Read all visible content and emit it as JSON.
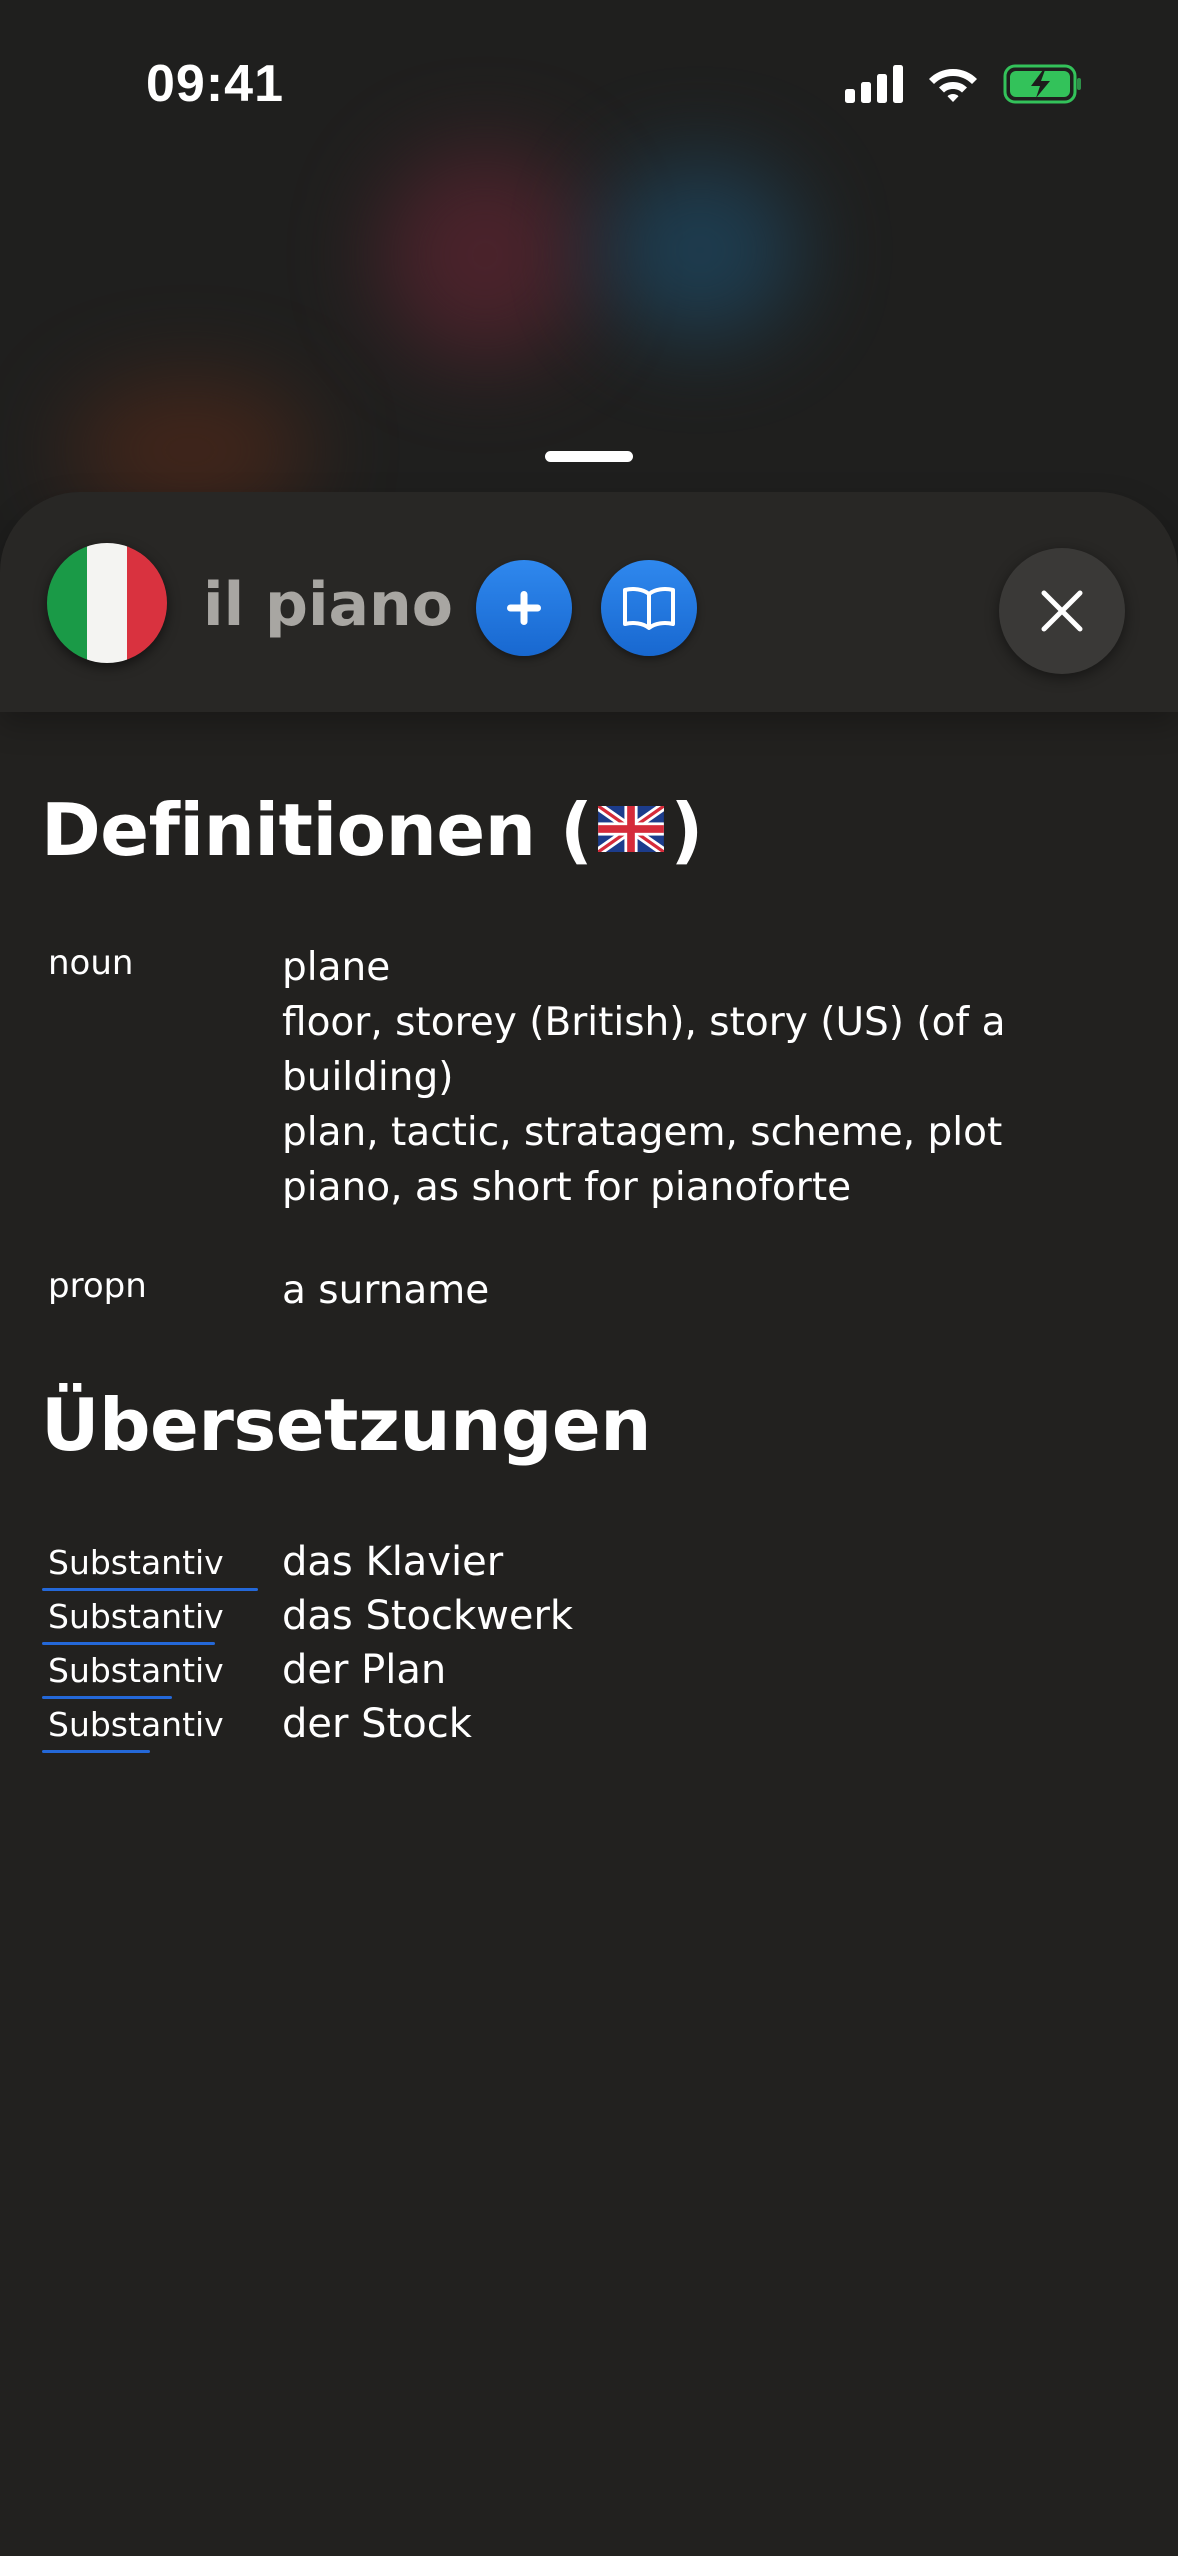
{
  "status_bar": {
    "time": "09:41",
    "icons": [
      "signal-icon",
      "wifi-icon",
      "battery-charging-icon"
    ]
  },
  "header": {
    "language_flag": "italy-flag-icon",
    "word": "il piano",
    "add_icon": "plus-icon",
    "dictionary_icon": "open-book-icon",
    "close_icon": "close-icon"
  },
  "definitions": {
    "title_prefix": "Definitionen (",
    "title_suffix": ")",
    "flag": "uk-flag-icon",
    "entries": [
      {
        "pos": "noun",
        "lines": [
          "plane",
          "floor, storey (British), story (US) (of a",
          "building)",
          "plan, tactic, stratagem, scheme, plot",
          "piano, as short for pianoforte"
        ]
      },
      {
        "pos": "propn",
        "lines": [
          "a surname"
        ]
      }
    ]
  },
  "translations": {
    "title": "Übersetzungen",
    "rows": [
      {
        "pos": "Substantiv",
        "word": "das Klavier",
        "relevance": 1.0
      },
      {
        "pos": "Substantiv",
        "word": "das Stockwerk",
        "relevance": 0.8
      },
      {
        "pos": "Substantiv",
        "word": "der Plan",
        "relevance": 0.6
      },
      {
        "pos": "Substantiv",
        "word": "der Stock",
        "relevance": 0.5
      }
    ]
  },
  "colors": {
    "accent_blue": "#1f78e6",
    "background": "#22211f",
    "italy_green": "#1a9a47",
    "italy_red": "#d9323f"
  }
}
